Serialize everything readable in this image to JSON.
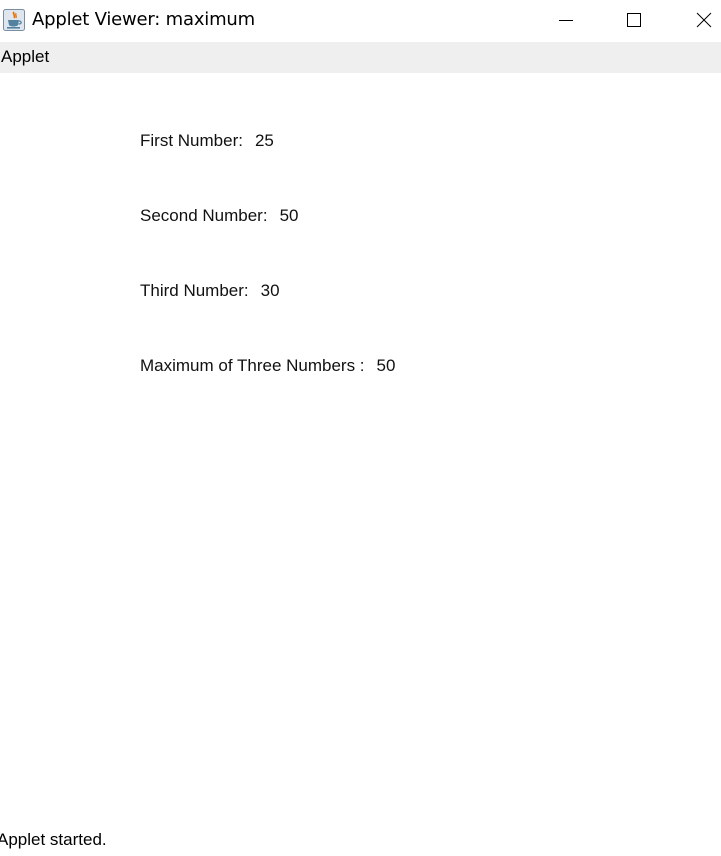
{
  "window": {
    "title": "Applet Viewer: maximum",
    "controls": [
      "minimize-icon",
      "maximize-icon",
      "close-icon"
    ]
  },
  "menubar": {
    "items": [
      {
        "label": "Applet"
      }
    ]
  },
  "applet": {
    "lines": [
      {
        "label": "First Number:",
        "value": "25"
      },
      {
        "label": "Second Number:",
        "value": "50"
      },
      {
        "label": "Third Number:",
        "value": "30"
      },
      {
        "label": "Maximum of Three Numbers :",
        "value": "50"
      }
    ]
  },
  "status": {
    "text": "Applet started."
  },
  "icons": {
    "app": "java-coffee-cup-icon"
  },
  "colors": {
    "menubar_bg": "#efefef",
    "java_orange": "#e76f00",
    "java_blue": "#5382a1"
  }
}
